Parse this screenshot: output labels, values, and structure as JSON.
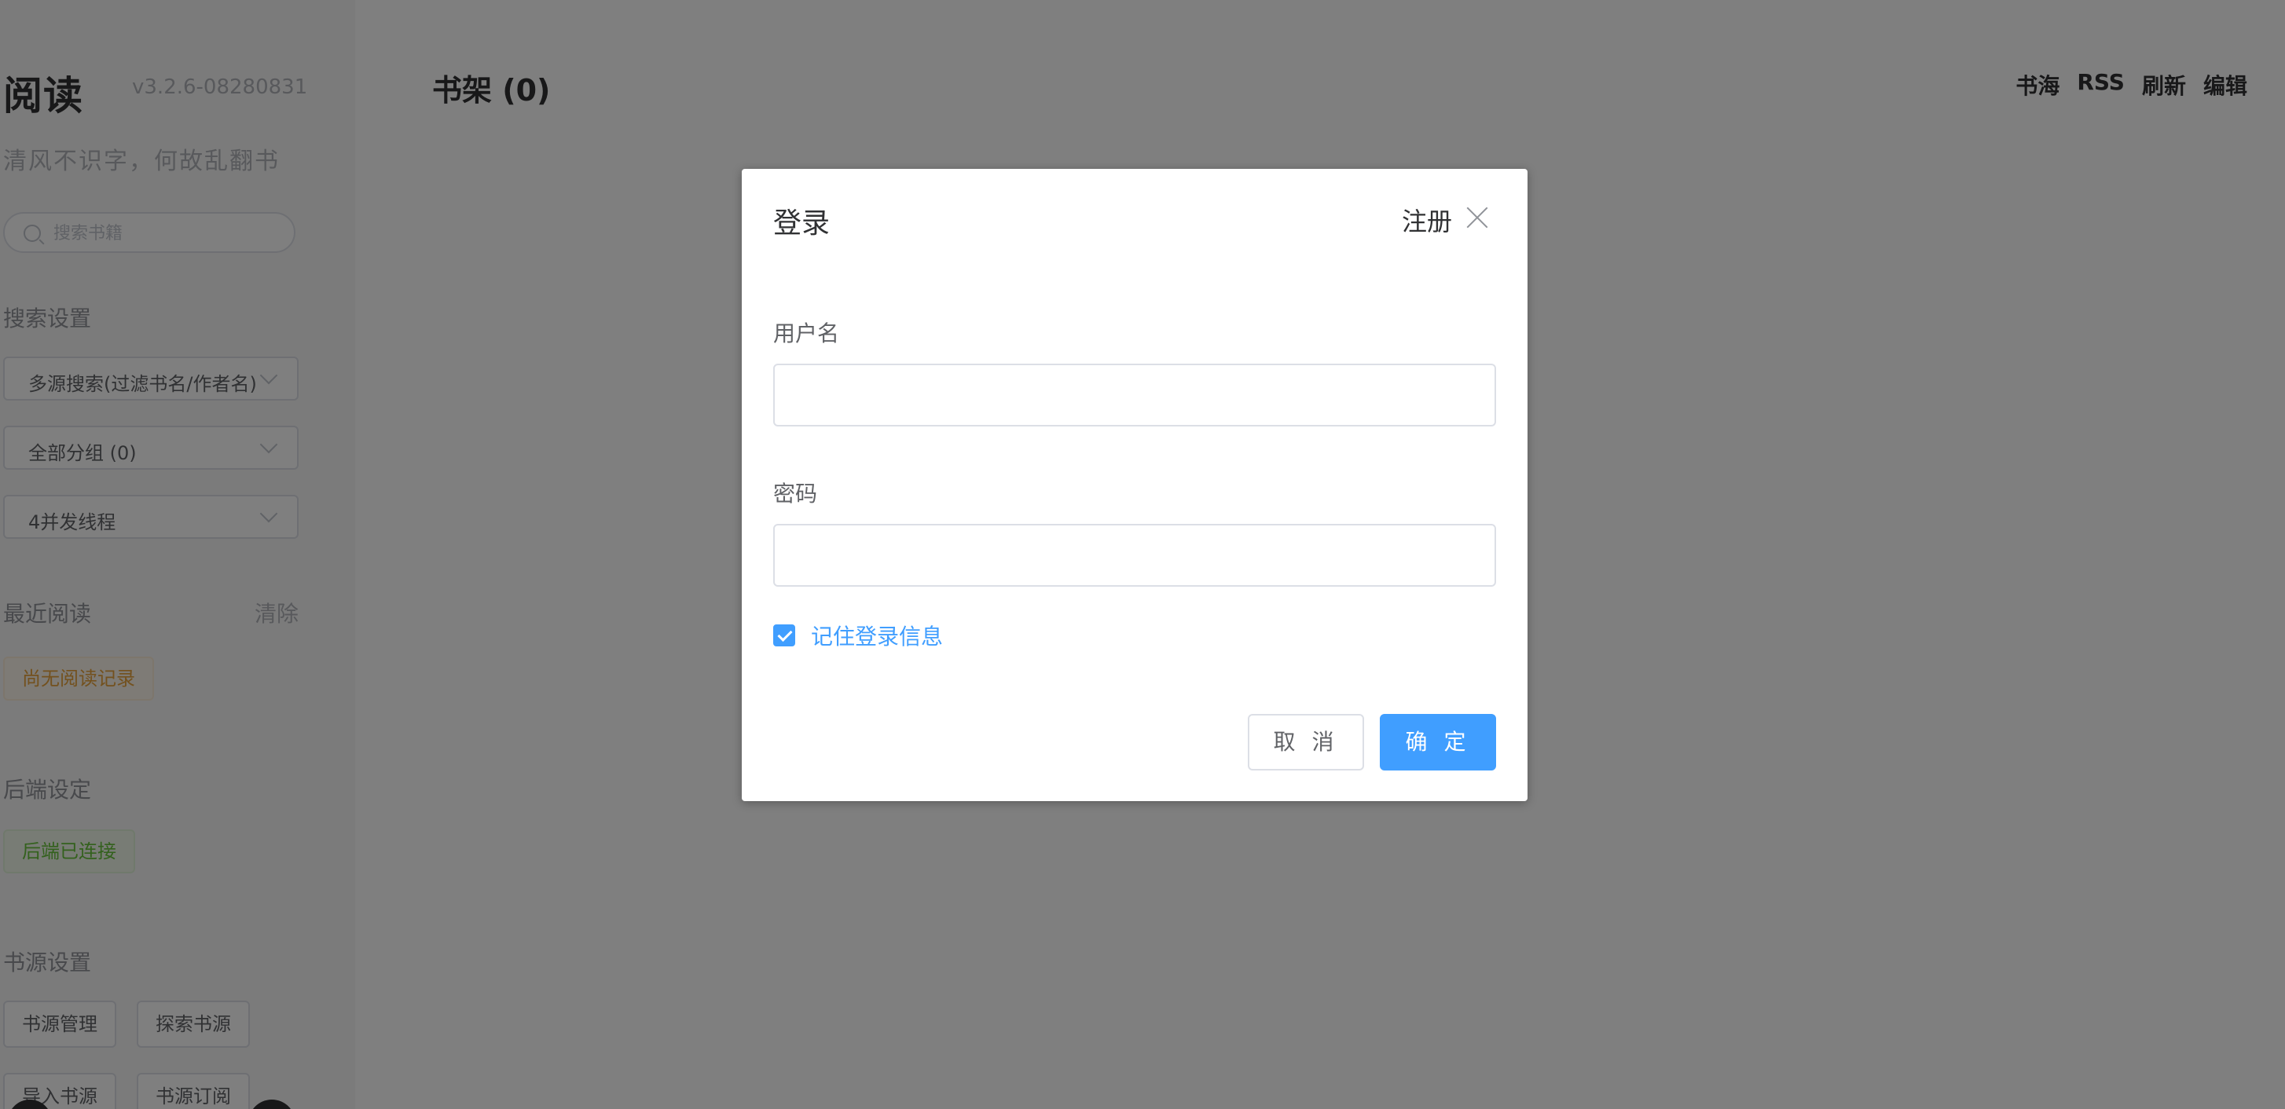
{
  "sidebar": {
    "brand": "阅读",
    "version": "v3.2.6-08280831",
    "slogan": "清风不识字，何故乱翻书",
    "search_placeholder": "搜索书籍",
    "search_settings_title": "搜索设置",
    "search_mode": "多源搜索(过滤书名/作者名)",
    "group_select": "全部分组 (0)",
    "thread_select": "4并发线程",
    "recent_title": "最近阅读",
    "recent_clear": "清除",
    "recent_empty": "尚无阅读记录",
    "backend_title": "后端设定",
    "backend_status": "后端已连接",
    "source_title": "书源设置",
    "source_buttons": [
      "书源管理",
      "探索书源",
      "导入书源",
      "书源订阅"
    ]
  },
  "main": {
    "shelf_title": "书架 (0)",
    "nav": [
      "书海",
      "RSS",
      "刷新",
      "编辑"
    ]
  },
  "dialog": {
    "title": "登录",
    "register": "注册",
    "username_label": "用户名",
    "password_label": "密码",
    "remember_label": "记住登录信息",
    "cancel": "取 消",
    "confirm": "确 定"
  },
  "colors": {
    "primary": "#409eff",
    "warning": "#e6a23c",
    "success": "#67c23a"
  }
}
